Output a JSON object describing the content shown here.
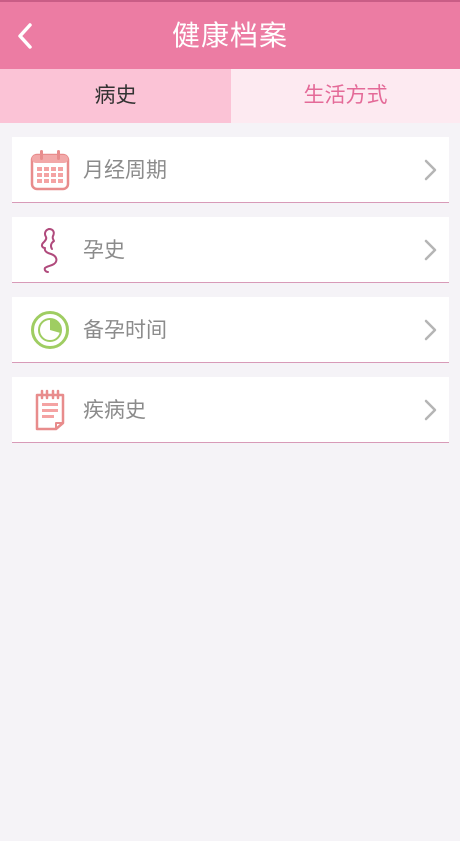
{
  "header": {
    "title": "健康档案",
    "back_icon": "chevron-left-icon"
  },
  "tabs": [
    {
      "label": "病史",
      "active": true
    },
    {
      "label": "生活方式",
      "active": false
    }
  ],
  "items": [
    {
      "label": "月经周期",
      "icon": "calendar-icon"
    },
    {
      "label": "孕史",
      "icon": "pregnant-silhouette-icon"
    },
    {
      "label": "备孕时间",
      "icon": "clock-icon"
    },
    {
      "label": "疾病史",
      "icon": "medical-record-icon"
    }
  ],
  "colors": {
    "header_bg": "#ec7ca3",
    "tab_active_bg": "#fbc3d6",
    "tab_inactive_bg": "#fdeaf1",
    "tab_inactive_text": "#e46a98",
    "page_bg": "#f5f3f7",
    "row_divider": "#d89ab8"
  }
}
